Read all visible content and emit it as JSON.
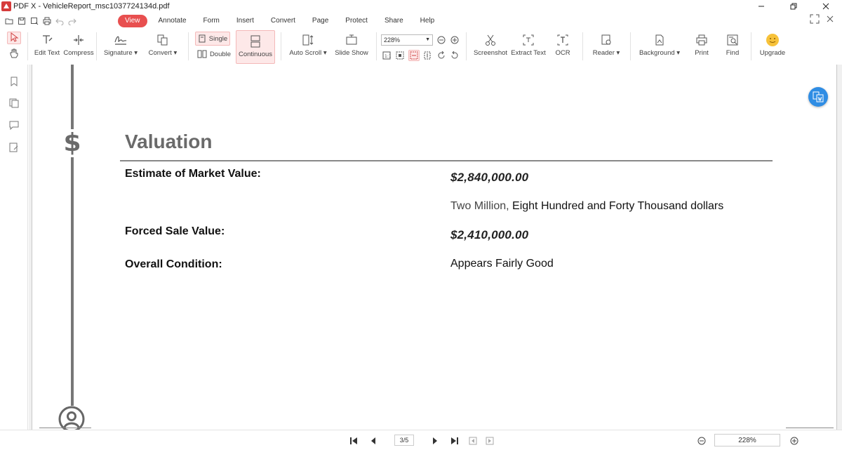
{
  "app": {
    "title": "PDF X - VehicleReport_msc1037724134d.pdf"
  },
  "menu": {
    "items": [
      {
        "label": "View"
      },
      {
        "label": "Annotate"
      },
      {
        "label": "Form"
      },
      {
        "label": "Insert"
      },
      {
        "label": "Convert"
      },
      {
        "label": "Page"
      },
      {
        "label": "Protect"
      },
      {
        "label": "Share"
      },
      {
        "label": "Help"
      }
    ]
  },
  "ribbon": {
    "edit_text": "Edit Text",
    "compress": "Compress",
    "signature": "Signature ▾",
    "convert": "Convert ▾",
    "single": "Single",
    "double": "Double",
    "continuous": "Continuous",
    "auto_scroll": "Auto Scroll ▾",
    "slide_show": "Slide Show",
    "zoom_value": "228%",
    "screenshot": "Screenshot",
    "extract_text": "Extract Text",
    "ocr": "OCR",
    "reader": "Reader ▾",
    "background": "Background ▾",
    "print": "Print",
    "find": "Find",
    "upgrade": "Upgrade"
  },
  "document": {
    "section_title": "Valuation",
    "rows": [
      {
        "label": "Estimate of Market Value:",
        "value": "$2,840,000.00"
      },
      {
        "label": "",
        "value_light": "Two Million,",
        "value": " Eight Hundred and Forty Thousand dollars"
      },
      {
        "label": "Forced Sale Value:",
        "value": "$2,410,000.00"
      },
      {
        "label": "Overall Condition:",
        "value": "Appears Fairly Good"
      }
    ]
  },
  "statusbar": {
    "page_indicator": "3/5",
    "zoom": "228%"
  },
  "colors": {
    "accent": "#e84f4f",
    "float_button": "#2f8de4"
  }
}
